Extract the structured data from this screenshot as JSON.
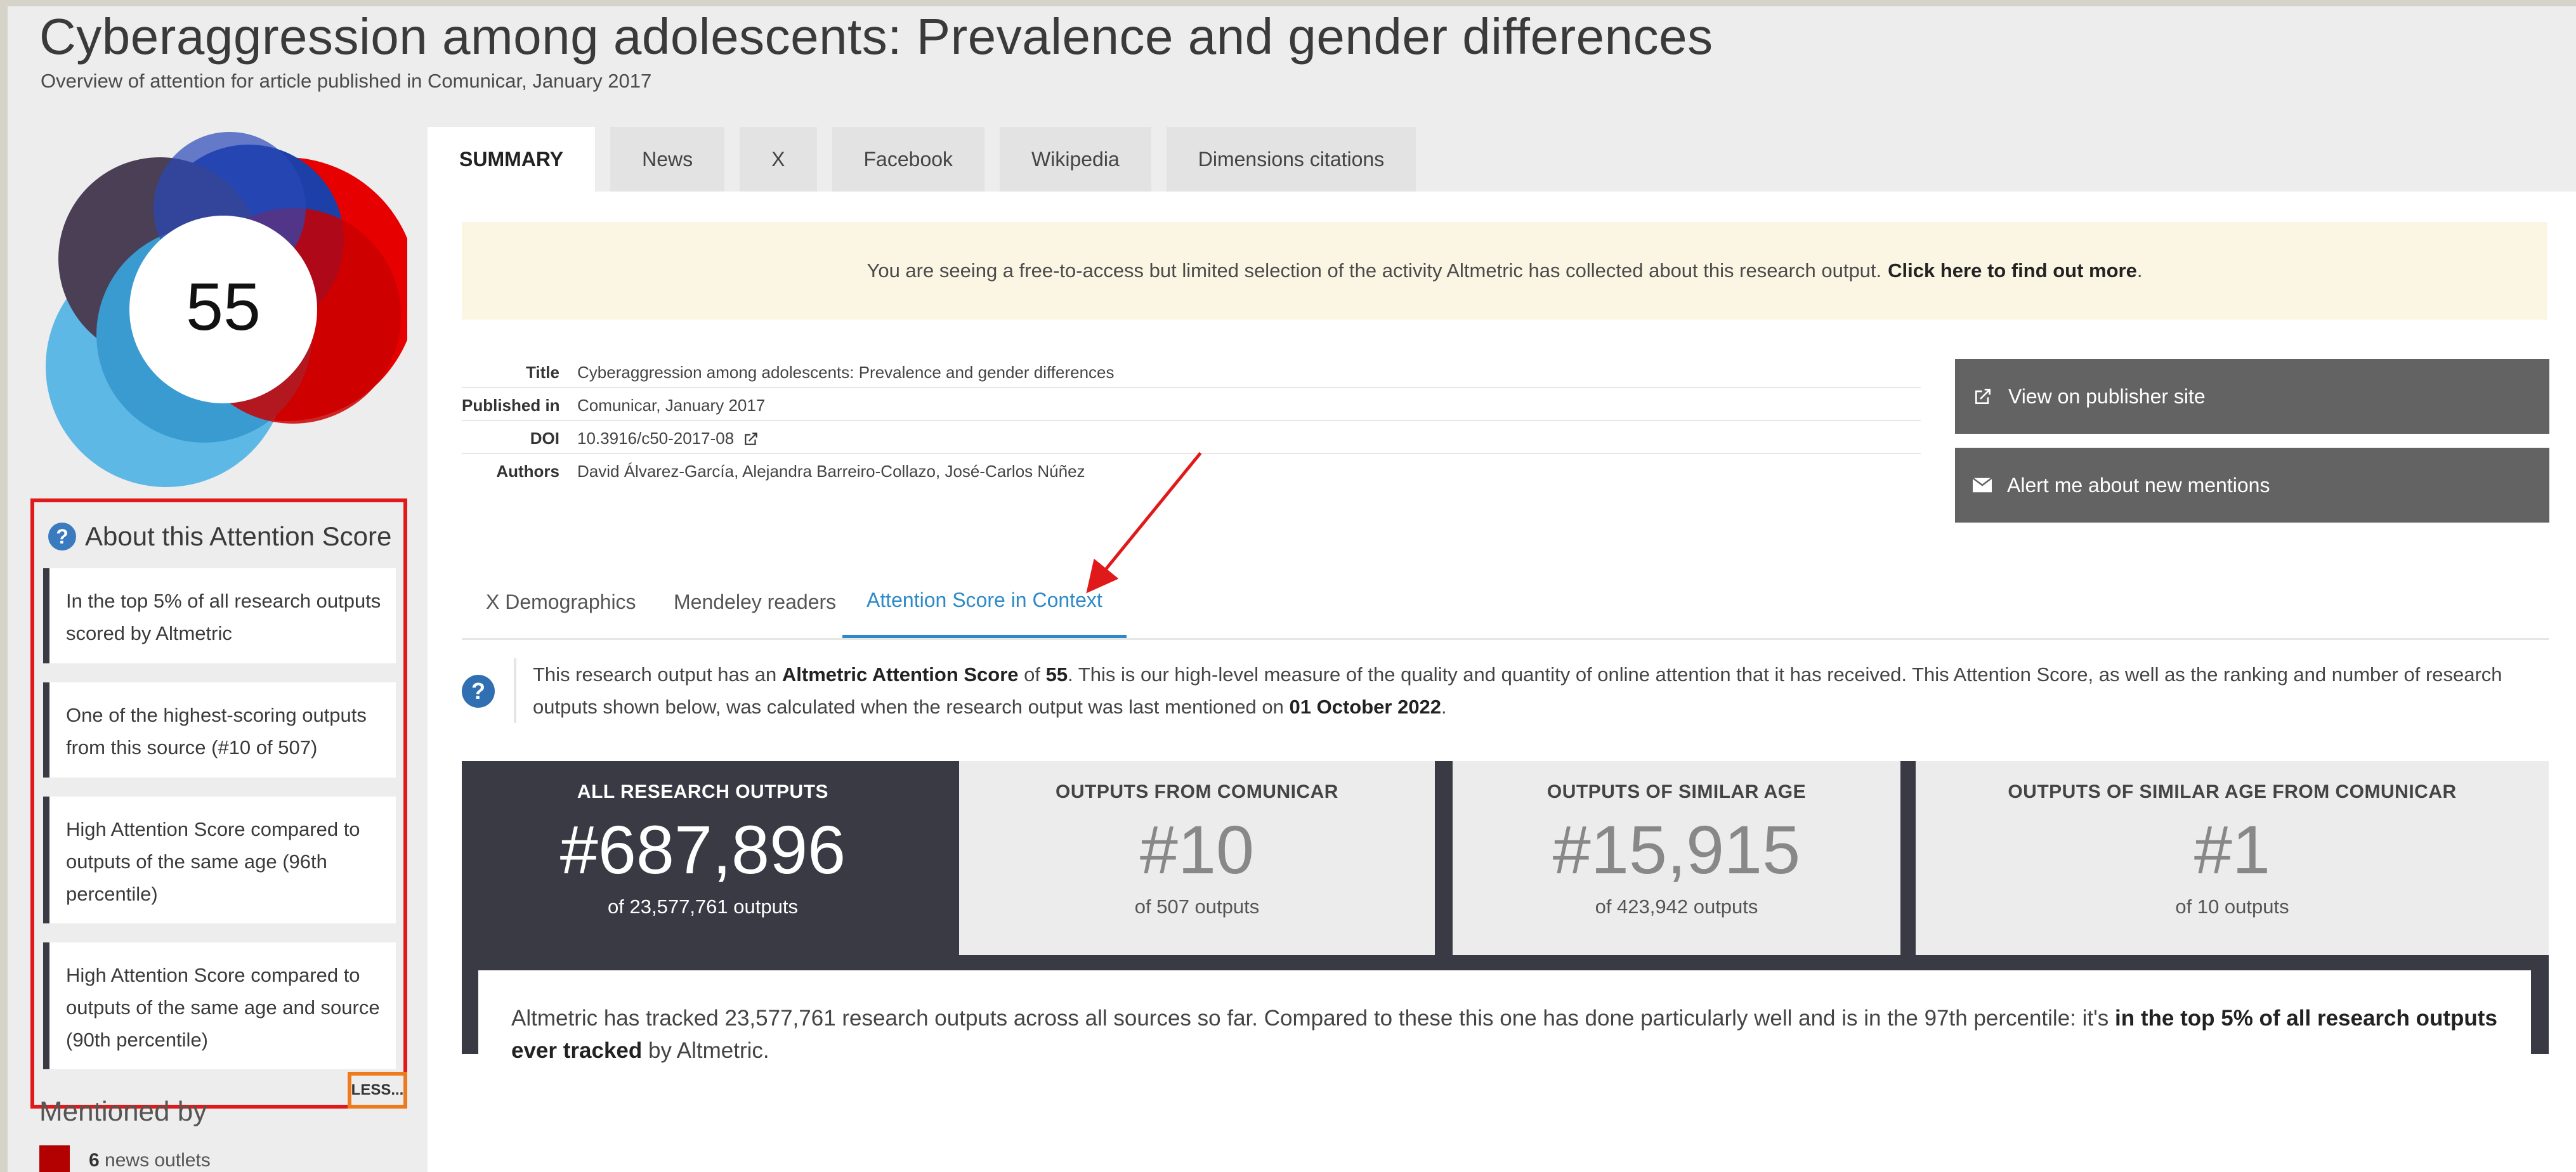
{
  "header": {
    "title": "Cyberaggression among adolescents: Prevalence and gender differences",
    "subtitle": "Overview of attention for article published in Comunicar, January 2017"
  },
  "score": {
    "value": "55",
    "colors": [
      "#e60000",
      "#1d3fa8",
      "#5eb8e6",
      "#4a3f55",
      "#3a9bd1"
    ]
  },
  "about": {
    "title": "About this Attention Score",
    "items": [
      "In the top 5% of all research outputs scored by Altmetric",
      "One of the highest-scoring outputs from this source (#10 of 507)",
      "High Attention Score compared to outputs of the same age (96th percentile)",
      "High Attention Score compared to outputs of the same age and source (90th percentile)"
    ],
    "less_label": "LESS..."
  },
  "mentioned": {
    "title": "Mentioned by",
    "count": "6",
    "label": "news outlets"
  },
  "tabs": [
    "SUMMARY",
    "News",
    "X",
    "Facebook",
    "Wikipedia",
    "Dimensions citations"
  ],
  "notice": {
    "text": "You are seeing a free-to-access but limited selection of the activity Altmetric has collected about this research output.",
    "link": "Click here to find out more",
    "tail": "."
  },
  "meta": {
    "title_label": "Title",
    "title_value": "Cyberaggression among adolescents: Prevalence and gender differences",
    "published_label": "Published in",
    "published_value": "Comunicar, January 2017",
    "doi_label": "DOI",
    "doi_value": "10.3916/c50-2017-08",
    "authors_label": "Authors",
    "authors_value": "David Álvarez-García, Alejandra Barreiro-Collazo, José-Carlos Núñez"
  },
  "buttons": {
    "publisher": "View on publisher site",
    "alert": "Alert me about new mentions"
  },
  "subtabs": [
    "X Demographics",
    "Mendeley readers",
    "Attention Score in Context"
  ],
  "info": {
    "p1": "This research output has an",
    "p2": "Altmetric Attention Score",
    "p3": "of",
    "p4": "55",
    "p5": ". This is our high-level measure of the quality and quantity of online attention that it has received. This Attention Score, as well as the ranking and number of research outputs shown below, was calculated when the research output was last mentioned on",
    "p6": "01 October 2022",
    "p7": "."
  },
  "scores": [
    {
      "head": "ALL RESEARCH OUTPUTS",
      "rank": "#687,896",
      "sub": "of 23,577,761 outputs"
    },
    {
      "head": "OUTPUTS FROM COMUNICAR",
      "rank": "#10",
      "sub": "of 507 outputs"
    },
    {
      "head": "OUTPUTS OF SIMILAR AGE",
      "rank": "#15,915",
      "sub": "of 423,942 outputs"
    },
    {
      "head": "OUTPUTS OF SIMILAR AGE FROM COMUNICAR",
      "rank": "#1",
      "sub": "of 10 outputs"
    }
  ],
  "context": {
    "t1": "Altmetric has tracked 23,577,761 research outputs across all sources so far. Compared to these this one has done particularly well and is in the 97th percentile: it's",
    "t2": "in the top 5% of all research outputs ever tracked",
    "t3": "by Altmetric."
  }
}
